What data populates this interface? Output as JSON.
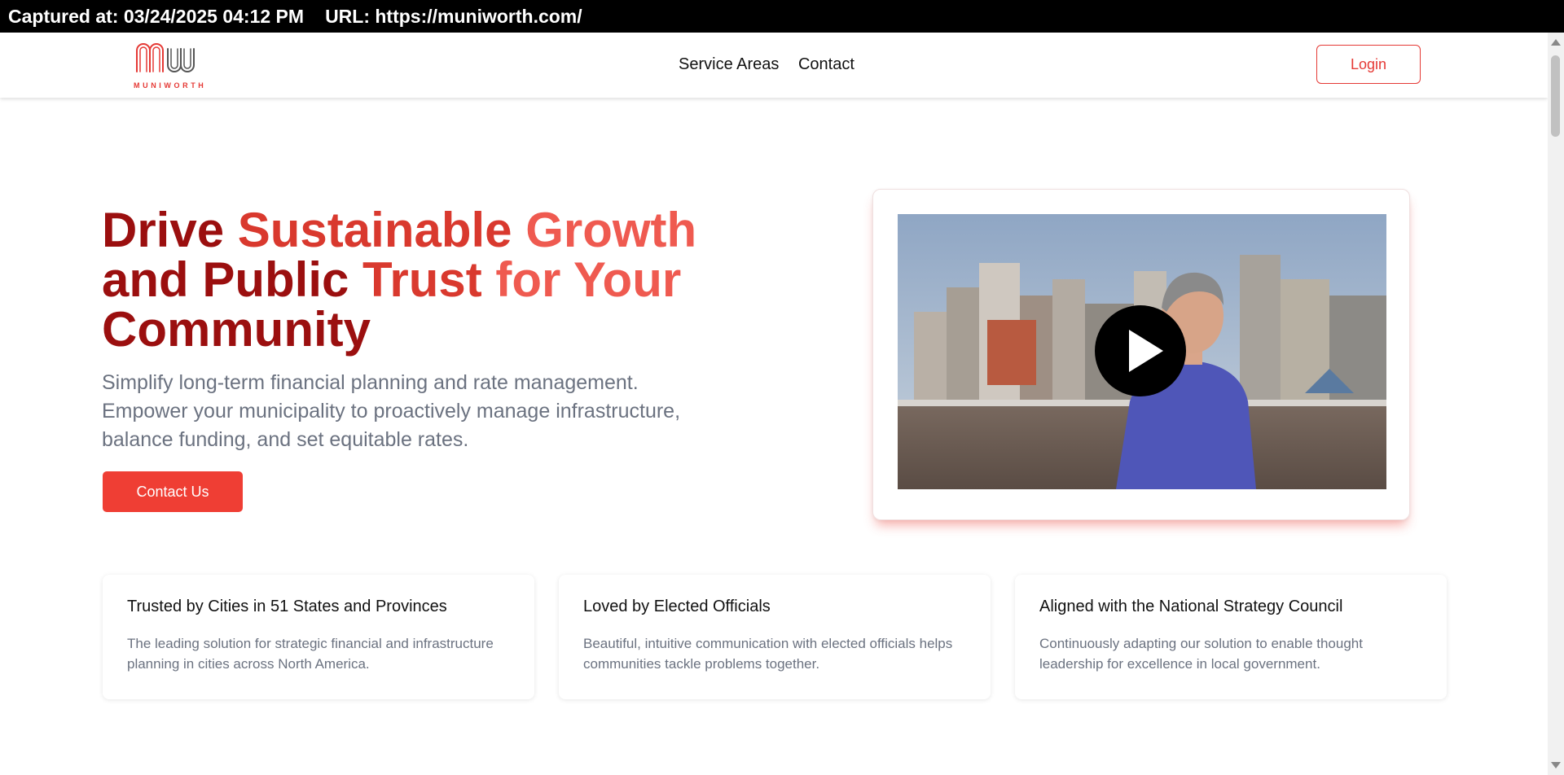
{
  "capture": {
    "captured_label": "Captured at: 03/24/2025 04:12 PM",
    "url_label": "URL: https://muniworth.com/"
  },
  "brand": {
    "name": "MUNIWORTH",
    "accent": "#e53935"
  },
  "nav": {
    "links": [
      "Service Areas",
      "Contact"
    ],
    "login_label": "Login"
  },
  "hero": {
    "title_parts": [
      "Drive ",
      "Sustainable ",
      "Growth",
      "and Public ",
      "Trust ",
      "for Your",
      "Community"
    ],
    "subtitle": "Simplify long-term financial planning and rate management. Empower your municipality to proactively manage infrastructure, balance funding, and set equitable rates.",
    "cta_label": "Contact Us"
  },
  "video": {
    "play_icon": "play-icon"
  },
  "features": [
    {
      "title": "Trusted by Cities in 51 States and Provinces",
      "text": "The leading solution for strategic financial and infrastructure planning in cities across North America."
    },
    {
      "title": "Loved by Elected Officials",
      "text": "Beautiful, intuitive communication with elected officials helps communities tackle problems together."
    },
    {
      "title": "Aligned with the National Strategy Council",
      "text": "Continuously adapting our solution to enable thought leadership for excellence in local government."
    }
  ]
}
